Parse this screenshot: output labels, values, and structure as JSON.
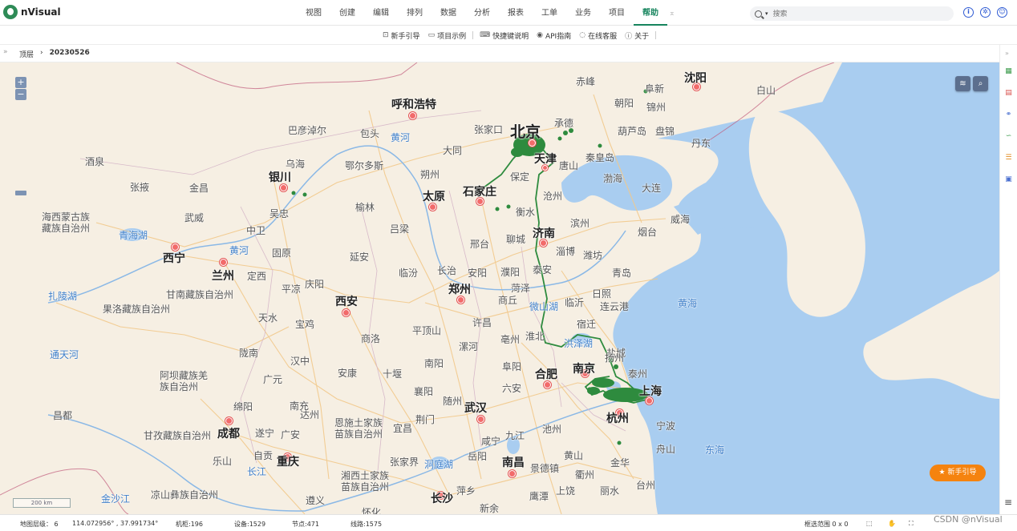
{
  "app": {
    "name": "nVisual"
  },
  "menu": [
    {
      "label": "视图"
    },
    {
      "label": "创建"
    },
    {
      "label": "编辑"
    },
    {
      "label": "排列"
    },
    {
      "label": "数据"
    },
    {
      "label": "分析"
    },
    {
      "label": "报表"
    },
    {
      "label": "工单"
    },
    {
      "label": "业务"
    },
    {
      "label": "项目"
    },
    {
      "label": "帮助",
      "active": true
    }
  ],
  "search": {
    "placeholder": "搜索"
  },
  "help_toolbar": [
    {
      "label": "新手引导",
      "icon": "guide-icon"
    },
    {
      "label": "项目示例",
      "icon": "folder-icon"
    },
    {
      "label": "快捷键说明",
      "icon": "keyboard-icon"
    },
    {
      "label": "API指南",
      "icon": "api-icon"
    },
    {
      "label": "在线客服",
      "icon": "chat-icon"
    },
    {
      "label": "关于",
      "icon": "info-icon"
    }
  ],
  "breadcrumb": {
    "root": "顶层",
    "separator": "›",
    "current": "20230526"
  },
  "map": {
    "labels_major": {
      "beijing": "北京",
      "tianjin": "天津",
      "shijiazhuang": "石家庄",
      "taiyuan": "太原",
      "huhehaote": "呼和浩特",
      "yinchuan": "银川",
      "xining": "西宁",
      "lanzhou": "兰州",
      "xian": "西安",
      "zhengzhou": "郑州",
      "jinan": "济南",
      "hefei": "合肥",
      "nanjing": "南京",
      "shanghai": "上海",
      "hangzhou": "杭州",
      "wuhan": "武汉",
      "chengdu": "成都",
      "chongqing": "重庆",
      "changsha": "长沙",
      "nanchang": "南昌",
      "shenyang": "沈阳"
    },
    "labels_minor": [
      "赤峰",
      "阜新",
      "朝阳",
      "锦州",
      "承德",
      "葫芦岛",
      "盘锦",
      "丹东",
      "秦皇岛",
      "唐山",
      "张家口",
      "大同",
      "包头",
      "巴彦淖尔",
      "乌海",
      "鄂尔多斯",
      "朔州",
      "保定",
      "沧州",
      "衡水",
      "大连",
      "渤海",
      "威海",
      "烟台",
      "滨州",
      "淄博",
      "潍坊",
      "青岛",
      "日照",
      "连云港",
      "临沂",
      "宿迁",
      "淮北",
      "亳州",
      "盐城",
      "泰安",
      "聊城",
      "邢台",
      "濮阳",
      "菏泽",
      "商丘",
      "长治",
      "安阳",
      "临汾",
      "吕梁",
      "榆林",
      "延安",
      "固原",
      "庆阳",
      "平凉",
      "定西",
      "天水",
      "宝鸡",
      "商洛",
      "十堰",
      "南阳",
      "平顶山",
      "漯河",
      "许昌",
      "阜阳",
      "六安",
      "襄阳",
      "随州",
      "荆门",
      "宜昌",
      "恩施土家族苗族自治州",
      "达州",
      "广安",
      "遂宁",
      "南充",
      "广元",
      "汉中",
      "安康",
      "陇南",
      "绵阳",
      "自贡",
      "乐山",
      "遵义",
      "张家界",
      "湘西土家族苗族自治州",
      "岳阳",
      "萍乡",
      "新余",
      "咸宁",
      "九江",
      "景德镇",
      "鹰潭",
      "上饶",
      "金华",
      "衢州",
      "丽水",
      "台州",
      "宁波",
      "舟山",
      "池州",
      "黄山",
      "扬州",
      "泰州",
      "盐城",
      "吴忠",
      "中卫",
      "武威",
      "金昌",
      "张掖",
      "酒泉",
      "昌都",
      "怀化",
      "黄海",
      "东海",
      "白山",
      "海西蒙古族藏族自治州",
      "甘南藏族自治州",
      "果洛藏族自治州",
      "阿坝藏族羌族自治州",
      "甘孜藏族自治州",
      "凉山彝族自治州"
    ],
    "labels_water": [
      "黄河",
      "青海湖",
      "扎陵湖",
      "通天河",
      "洪泽湖",
      "微山湖",
      "洞庭湖",
      "长江",
      "金沙江",
      "黄海",
      "东海",
      "渤海"
    ],
    "colors": {
      "land": "#f6efe3",
      "sea": "#a9cdf0",
      "route": "#2e8b3e",
      "city_dot": "#f26b6b",
      "road": "#f2c98b",
      "border": "#c05a7a"
    },
    "scale_text": "200 km",
    "guide_button": "新手引导"
  },
  "status": {
    "zoom_label": "地图层级：",
    "zoom_value": "6",
    "coords": "114.072956° , 37.991734°",
    "cabinets_label": "机柜:",
    "cabinets": "196",
    "devices_label": "设备:",
    "devices": "1529",
    "nodes_label": "节点:",
    "nodes": "471",
    "lines_label": "线路:",
    "lines": "1575",
    "selection_label": "框选范围",
    "selection": "0 x 0",
    "zoom_percent": "100%"
  },
  "watermark": "CSDN @nVisual"
}
